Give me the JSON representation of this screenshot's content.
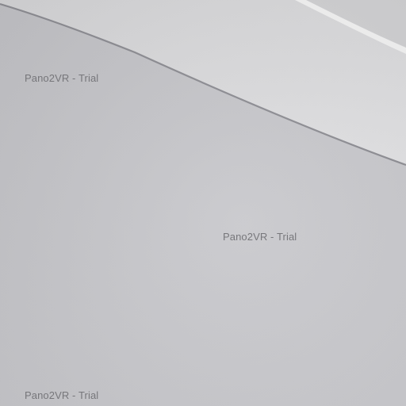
{
  "watermarks": [
    "Pano2VR - Trial",
    "Pano2VR - Trial",
    "Pano2VR - Trial"
  ],
  "colors": {
    "wall": "#c6c6ca",
    "ceiling": "#dedee0",
    "edge_line": "#8e8e94",
    "trim": "#f2f2f2",
    "watermark": "#6f6f73"
  }
}
